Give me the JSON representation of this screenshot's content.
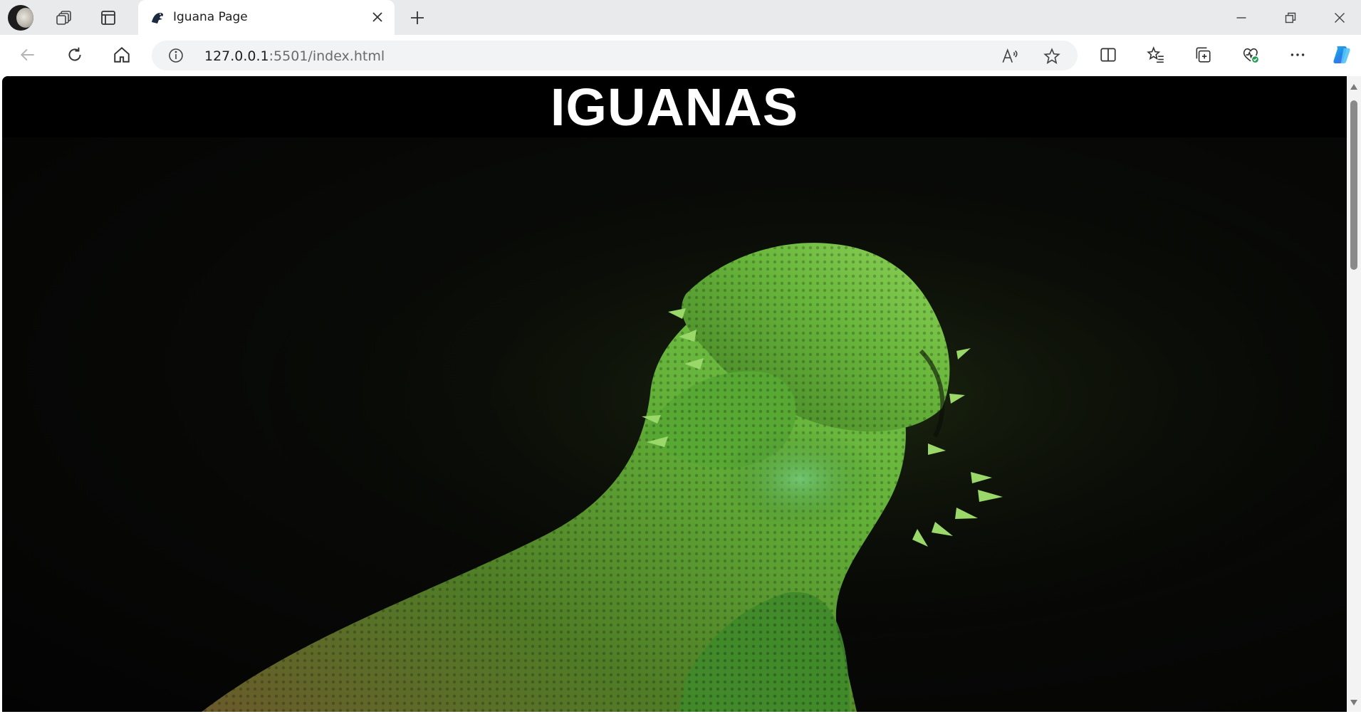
{
  "browser": {
    "tab": {
      "title": "Iguana Page"
    },
    "address_bar": {
      "host": "127.0.0.1",
      "port": ":5501",
      "path": "/index.html"
    }
  },
  "page": {
    "header": {
      "title": "IGUANAS"
    },
    "hero": {
      "alt": "Green iguana close-up on dark background"
    }
  },
  "colors": {
    "header_bg": "#000000",
    "title_text": "#ffffff",
    "iguana_green": "#5fae3a",
    "copilot_accent": "#1e88e5"
  }
}
